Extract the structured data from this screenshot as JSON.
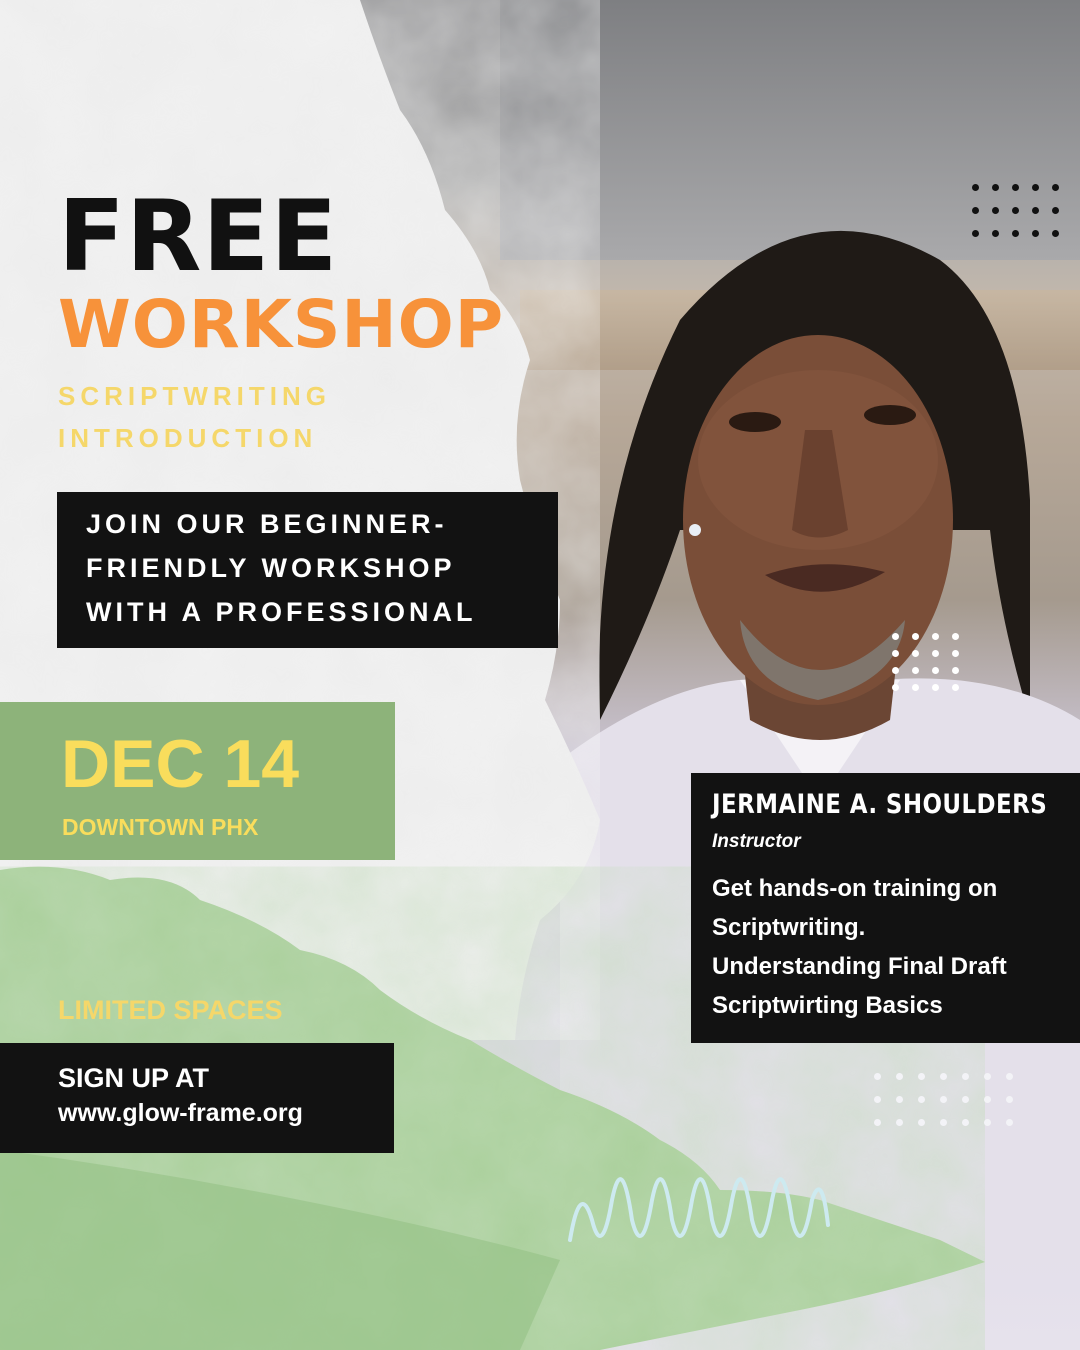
{
  "headline": {
    "free": "FREE",
    "workshop": "WORKSHOP",
    "subtitle_line1": "SCRIPTWRITING",
    "subtitle_line2": "INTRODUCTION"
  },
  "intro": {
    "line1": "JOIN OUR BEGINNER-",
    "line2": "FRIENDLY WORKSHOP",
    "line3": "WITH A PROFESSIONAL"
  },
  "event": {
    "date": "DEC 14",
    "location": "DOWNTOWN PHX"
  },
  "signup": {
    "limited": "LIMITED SPACES",
    "label": "SIGN UP AT",
    "url": "www.glow-frame.org"
  },
  "instructor": {
    "name": "JERMAINE A. SHOULDERS",
    "role": "Instructor",
    "details": [
      "Get hands-on training on",
      "Scriptwriting.",
      "Understanding Final Draft",
      "Scriptwirting Basics"
    ]
  },
  "colors": {
    "black_box": "#121212",
    "orange": "#f7923a",
    "yellow": "#f9dd5c",
    "green": "#8db37a",
    "light_green": "#a9cf9a"
  },
  "decor": {
    "photo": "portrait-photo",
    "dot_pattern": "dot-grid-icon",
    "squiggle": "zigzag-squiggle-icon"
  }
}
